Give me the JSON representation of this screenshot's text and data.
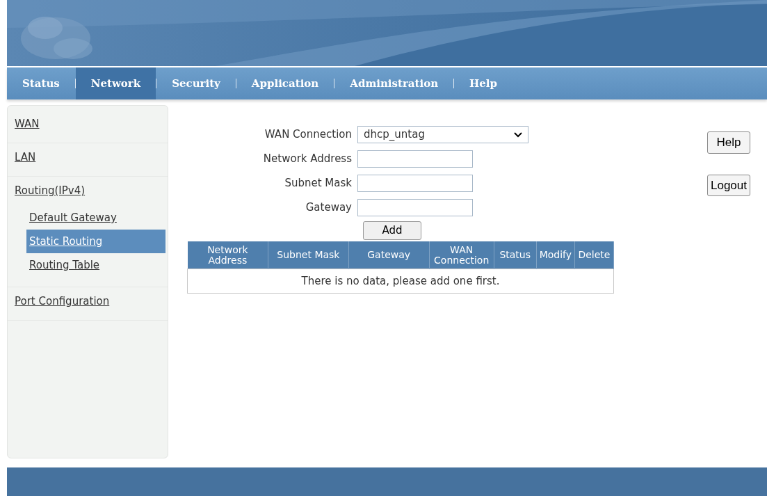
{
  "banner": {
    "kind": "picture"
  },
  "tabs": [
    {
      "label": "Status",
      "selected": false
    },
    {
      "label": "Network",
      "selected": true
    },
    {
      "label": "Security",
      "selected": false
    },
    {
      "label": "Application",
      "selected": false
    },
    {
      "label": "Administration",
      "selected": false
    },
    {
      "label": "Help",
      "selected": false
    }
  ],
  "sidebar": {
    "items": [
      {
        "label": "WAN",
        "selected": false
      },
      {
        "label": "LAN",
        "selected": false
      },
      {
        "label": "Routing(IPv4)",
        "selected": false,
        "children": [
          {
            "label": "Default Gateway",
            "selected": false
          },
          {
            "label": "Static Routing",
            "selected": true
          },
          {
            "label": "Routing Table",
            "selected": false
          }
        ]
      },
      {
        "label": "Port Configuration",
        "selected": false
      }
    ]
  },
  "form": {
    "fields": [
      {
        "label": "WAN Connection",
        "kind": "select",
        "value": "dhcp_untag"
      },
      {
        "label": "Network Address",
        "kind": "text"
      },
      {
        "label": "Subnet Mask",
        "kind": "text"
      },
      {
        "label": "Gateway",
        "kind": "text"
      }
    ],
    "add_button": "Add"
  },
  "side_buttons": [
    "Help",
    "Logout"
  ],
  "table": {
    "columns": [
      "Network Address",
      "Subnet Mask",
      "Gateway",
      "WAN Connection",
      "Status",
      "Modify",
      "Delete"
    ],
    "empty_message": "There is no data, please add one first."
  }
}
